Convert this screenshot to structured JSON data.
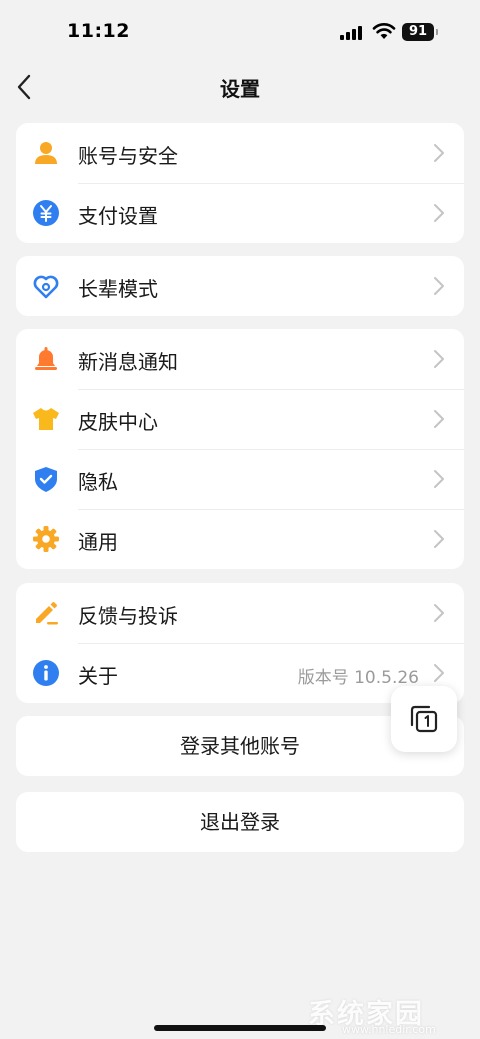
{
  "status_bar": {
    "time": "11:12",
    "battery": "91"
  },
  "nav": {
    "title": "设置"
  },
  "groups": [
    {
      "items": [
        {
          "label": "账号与安全",
          "icon": "user-icon"
        },
        {
          "label": "支付设置",
          "icon": "yen-icon"
        }
      ]
    },
    {
      "items": [
        {
          "label": "长辈模式",
          "icon": "heart-icon"
        }
      ]
    },
    {
      "items": [
        {
          "label": "新消息通知",
          "icon": "bell-icon"
        },
        {
          "label": "皮肤中心",
          "icon": "tshirt-icon"
        },
        {
          "label": "隐私",
          "icon": "shield-check-icon"
        },
        {
          "label": "通用",
          "icon": "gear-icon"
        }
      ]
    },
    {
      "items": [
        {
          "label": "反馈与投诉",
          "icon": "pencil-icon"
        },
        {
          "label": "关于",
          "icon": "info-icon",
          "value": "版本号 10.5.26"
        }
      ]
    }
  ],
  "buttons": {
    "switch_account": "登录其他账号",
    "logout": "退出登录"
  },
  "watermark": {
    "text": "系统家园",
    "url": "www.hnledir.com"
  },
  "colors": {
    "orange": "#f9a825",
    "blue": "#2f7ff0",
    "bell": "#ff7a2e",
    "background": "#f2f2f2"
  }
}
